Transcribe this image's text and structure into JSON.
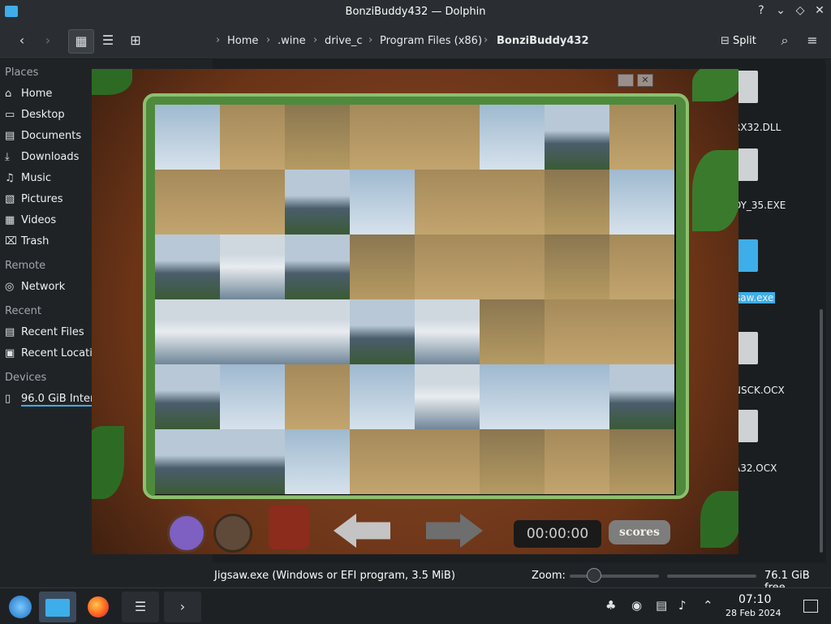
{
  "window": {
    "title": "BonziBuddy432 — Dolphin"
  },
  "toolbar": {
    "breadcrumb": [
      "Home",
      ".wine",
      "drive_c",
      "Program Files (x86)",
      "BonziBuddy432"
    ],
    "split_label": "Split"
  },
  "sidebar": {
    "places_header": "Places",
    "places": [
      "Home",
      "Desktop",
      "Documents",
      "Downloads",
      "Music",
      "Pictures",
      "Videos",
      "Trash"
    ],
    "remote_header": "Remote",
    "remote": [
      "Network"
    ],
    "recent_header": "Recent",
    "recent": [
      "Recent Files",
      "Recent Locati"
    ],
    "devices_header": "Devices",
    "devices": [
      "96.0 GiB Inter"
    ]
  },
  "files": [
    "RX32.DLL",
    "DY_35.EXE",
    "saw.exe",
    "NSCK.OCX",
    "A32.OCX"
  ],
  "game": {
    "timer": "00:00:00",
    "scores_label": "scores"
  },
  "statusbar": {
    "selection": "Jigsaw.exe (Windows or EFI program, 3.5 MiB)",
    "zoom_label": "Zoom:",
    "free_space": "76.1 GiB free"
  },
  "taskbar": {
    "time": "07:10",
    "date": "28 Feb 2024"
  },
  "colors": {
    "accent": "#3daee9",
    "window_bg": "#202326",
    "wood": "#6b3417",
    "frame_green": "#4f8a3c"
  }
}
